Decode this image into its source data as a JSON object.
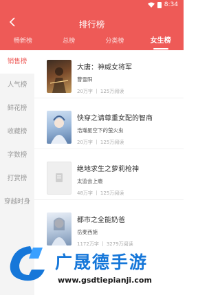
{
  "statusbar": {
    "time": "8:34"
  },
  "header": {
    "title": "排行榜"
  },
  "tabs": [
    {
      "label": "畅新榜",
      "active": false
    },
    {
      "label": "总榜",
      "active": false
    },
    {
      "label": "分类榜",
      "active": false
    },
    {
      "label": "女生榜",
      "active": true
    }
  ],
  "sidebar": {
    "items": [
      {
        "label": "销售榜",
        "active": true
      },
      {
        "label": "人气榜",
        "active": false
      },
      {
        "label": "鲜花榜",
        "active": false
      },
      {
        "label": "收藏榜",
        "active": false
      },
      {
        "label": "字数榜",
        "active": false
      },
      {
        "label": "打赏榜",
        "active": false
      },
      {
        "label": "穿越时身",
        "active": false
      }
    ]
  },
  "books": [
    {
      "title": "大唐：神威女将军",
      "author": "曹雪阳",
      "words": "20万字",
      "reads": "125万阅读"
    },
    {
      "title": "快穿之请尊重女配的智商",
      "author": "浩瀚星空下的萤火虫",
      "words": "20万字",
      "reads": "125万阅读"
    },
    {
      "title": "绝地求生之萝莉枪神",
      "author": "太监会上瘾",
      "words": "48万字",
      "reads": "125万阅读"
    },
    {
      "title": "都市之全能奶爸",
      "author": "岳麦西施",
      "words": "1172万字",
      "reads": "3279万阅读"
    }
  ],
  "watermark": {
    "brand": "广晟德手游",
    "url": "www.gsdtiepianji.com"
  },
  "icons": [
    "back-arrow-icon",
    "wifi-icon",
    "battery-icon",
    "book-placeholder-icon",
    "brand-logo-icon"
  ],
  "colors": {
    "accent": "#ee5a57",
    "sidebar_bg": "#f4f4f4",
    "brand_blue": "#1677d9"
  }
}
